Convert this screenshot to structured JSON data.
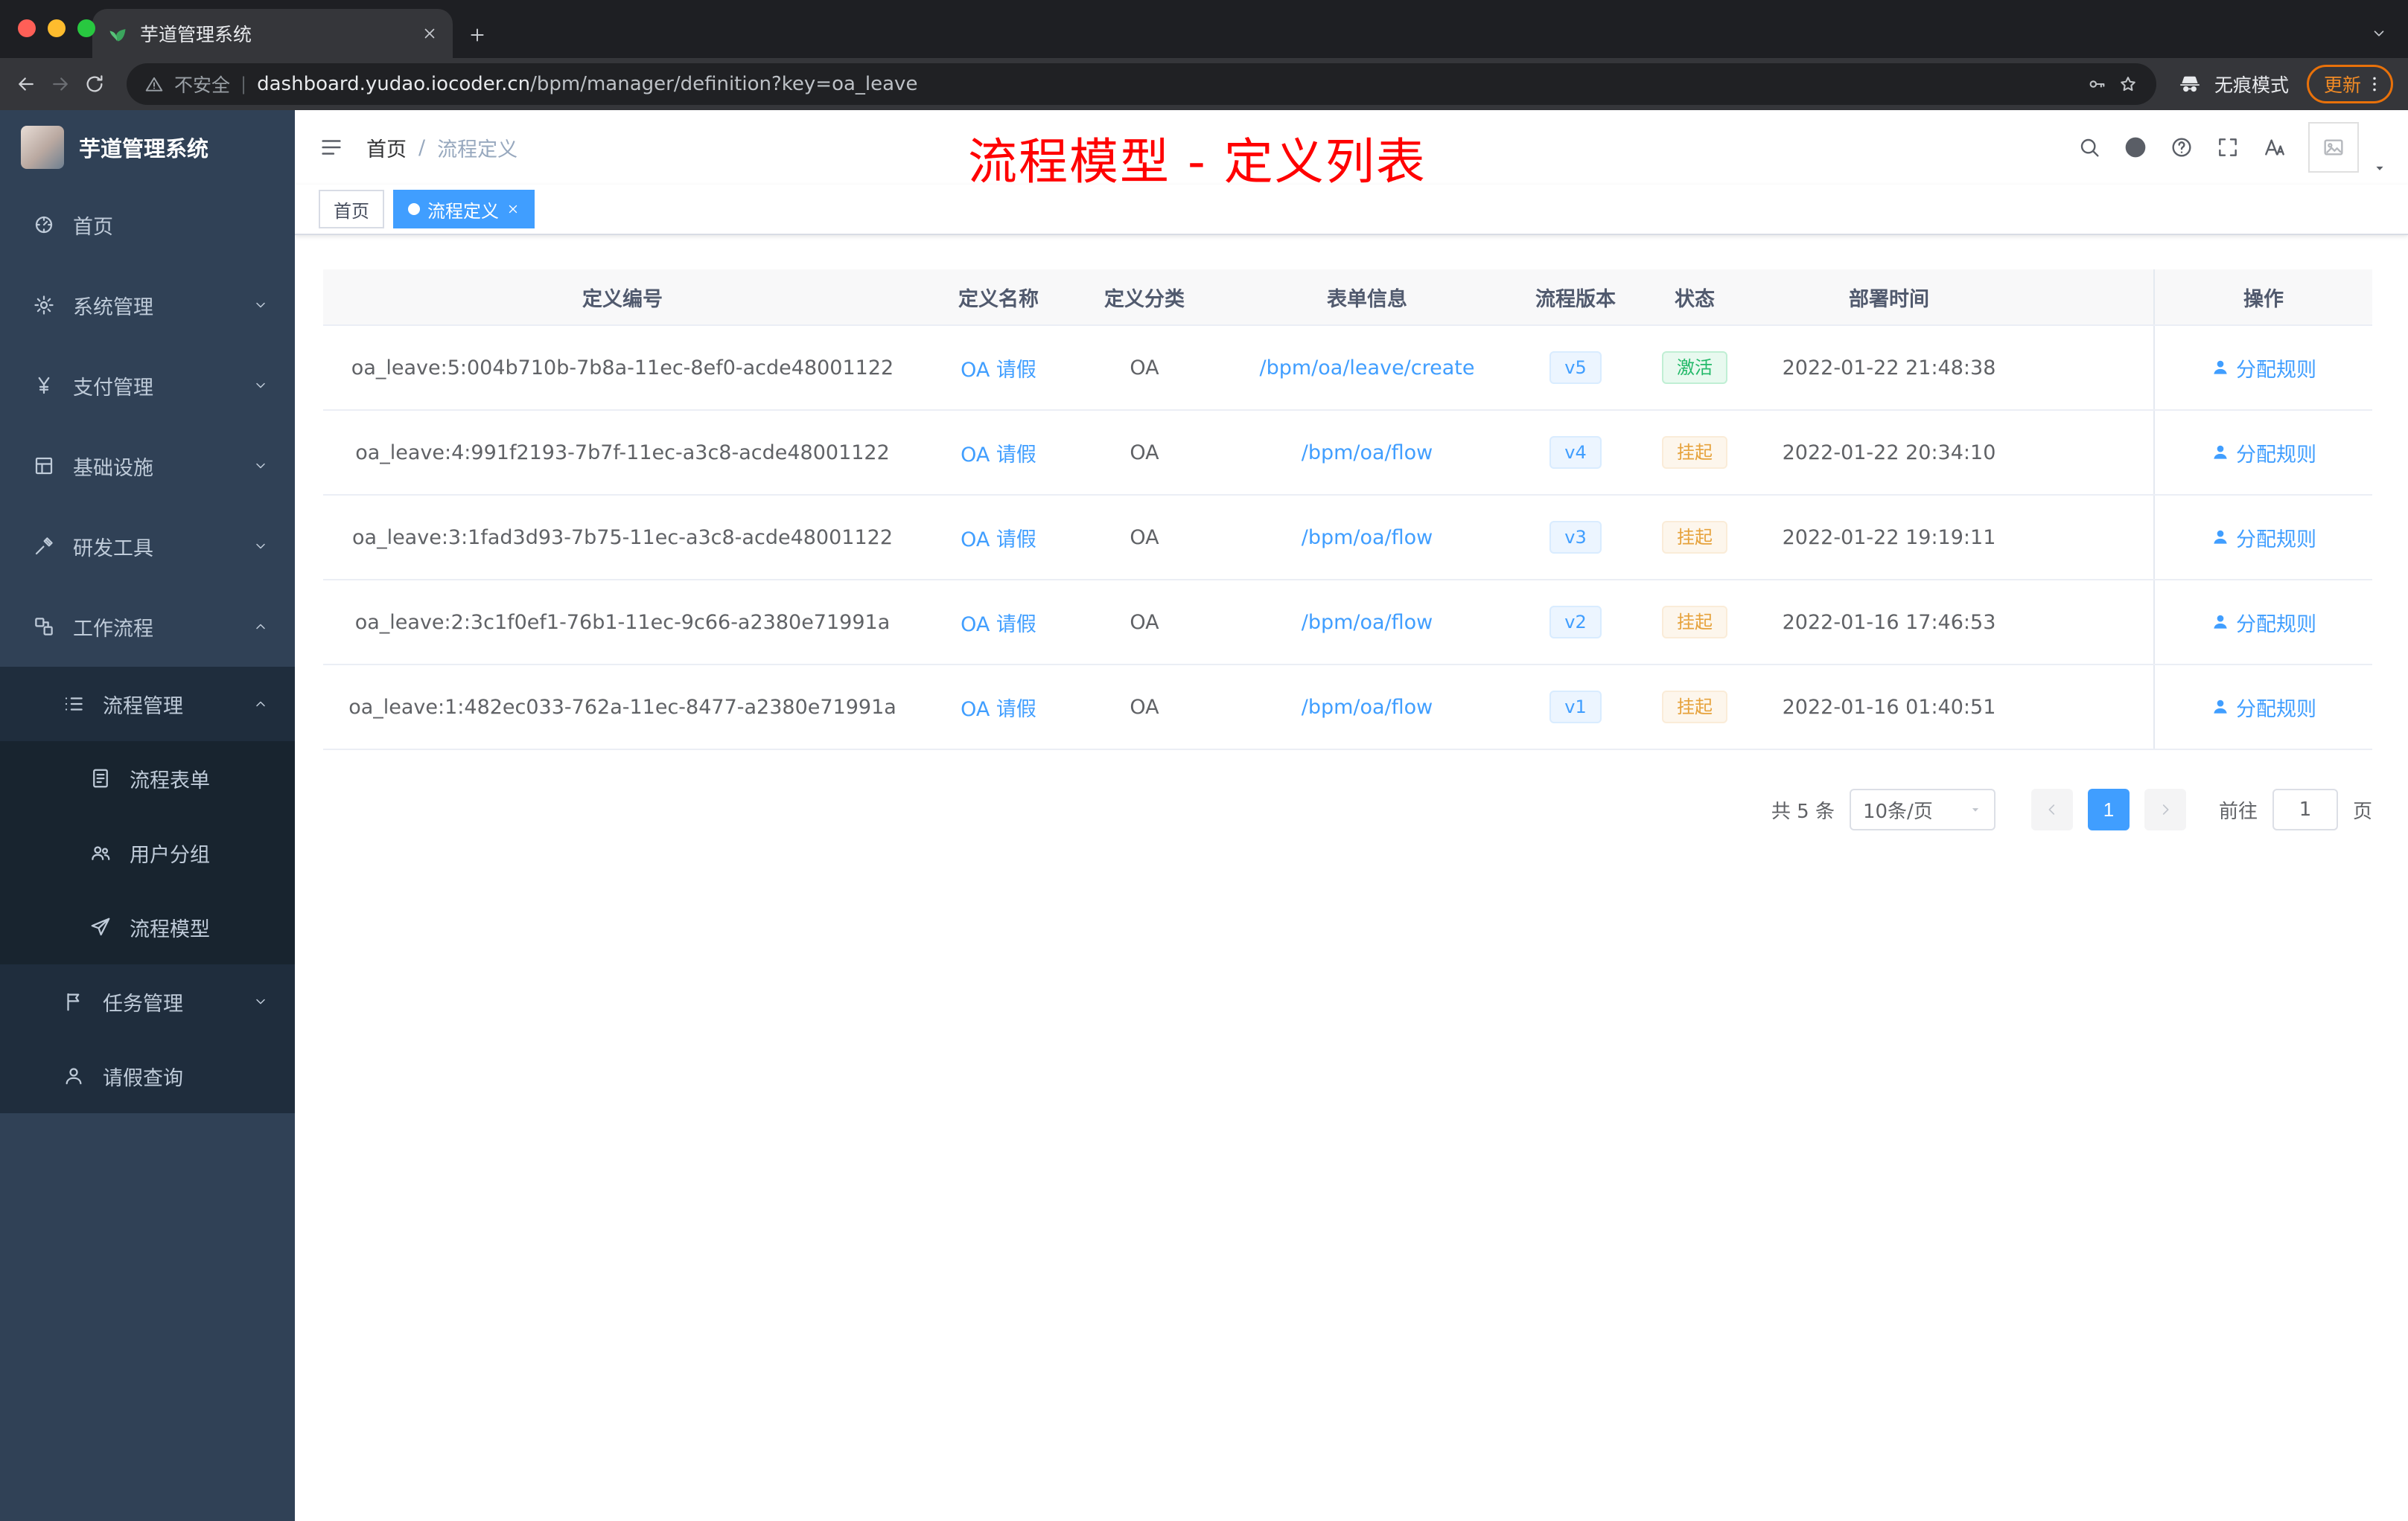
{
  "browser": {
    "tab_title": "芋道管理系统",
    "security_label": "不安全",
    "url_host": "dashboard.yudao.iocoder.cn",
    "url_path": "/bpm/manager/definition?key=oa_leave",
    "incognito_label": "无痕模式",
    "update_label": "更新"
  },
  "sidebar": {
    "title": "芋道管理系统",
    "menu": [
      {
        "label": "首页",
        "icon": "dashboard-icon",
        "level": 1,
        "chevron": ""
      },
      {
        "label": "系统管理",
        "icon": "gear-icon",
        "level": 1,
        "chevron": "down"
      },
      {
        "label": "支付管理",
        "icon": "yen-icon",
        "level": 1,
        "chevron": "down"
      },
      {
        "label": "基础设施",
        "icon": "infra-icon",
        "level": 1,
        "chevron": "down"
      },
      {
        "label": "研发工具",
        "icon": "tools-icon",
        "level": 1,
        "chevron": "down"
      },
      {
        "label": "工作流程",
        "icon": "workflow-icon",
        "level": 1,
        "chevron": "up"
      },
      {
        "label": "流程管理",
        "icon": "list-icon",
        "level": 2,
        "chevron": "up"
      },
      {
        "label": "流程表单",
        "icon": "form-icon",
        "level": 3,
        "chevron": ""
      },
      {
        "label": "用户分组",
        "icon": "group-icon",
        "level": 3,
        "chevron": ""
      },
      {
        "label": "流程模型",
        "icon": "send-icon",
        "level": 3,
        "chevron": ""
      },
      {
        "label": "任务管理",
        "icon": "tasks-icon",
        "level": 2,
        "chevron": "down"
      },
      {
        "label": "请假查询",
        "icon": "user-icon",
        "level": 2,
        "chevron": ""
      }
    ]
  },
  "header": {
    "breadcrumb": [
      "首页",
      "流程定义"
    ],
    "separator": "/",
    "annotation": "流程模型 - 定义列表"
  },
  "tags": [
    {
      "label": "首页",
      "active": false,
      "closable": false
    },
    {
      "label": "流程定义",
      "active": true,
      "closable": true
    }
  ],
  "table": {
    "columns": [
      "定义编号",
      "定义名称",
      "定义分类",
      "表单信息",
      "流程版本",
      "状态",
      "部署时间",
      "操作"
    ],
    "action_label": "分配规则",
    "rows": [
      {
        "id": "oa_leave:5:004b710b-7b8a-11ec-8ef0-acde48001122",
        "name": "OA 请假",
        "category": "OA",
        "form": "/bpm/oa/leave/create",
        "version": "v5",
        "status": "激活",
        "status_type": "success",
        "time": "2022-01-22 21:48:38"
      },
      {
        "id": "oa_leave:4:991f2193-7b7f-11ec-a3c8-acde48001122",
        "name": "OA 请假",
        "category": "OA",
        "form": "/bpm/oa/flow",
        "version": "v4",
        "status": "挂起",
        "status_type": "warning",
        "time": "2022-01-22 20:34:10"
      },
      {
        "id": "oa_leave:3:1fad3d93-7b75-11ec-a3c8-acde48001122",
        "name": "OA 请假",
        "category": "OA",
        "form": "/bpm/oa/flow",
        "version": "v3",
        "status": "挂起",
        "status_type": "warning",
        "time": "2022-01-22 19:19:11"
      },
      {
        "id": "oa_leave:2:3c1f0ef1-76b1-11ec-9c66-a2380e71991a",
        "name": "OA 请假",
        "category": "OA",
        "form": "/bpm/oa/flow",
        "version": "v2",
        "status": "挂起",
        "status_type": "warning",
        "time": "2022-01-16 17:46:53"
      },
      {
        "id": "oa_leave:1:482ec033-762a-11ec-8477-a2380e71991a",
        "name": "OA 请假",
        "category": "OA",
        "form": "/bpm/oa/flow",
        "version": "v1",
        "status": "挂起",
        "status_type": "warning",
        "time": "2022-01-16 01:40:51"
      }
    ]
  },
  "pagination": {
    "total_label": "共 5 条",
    "page_size": "10条/页",
    "current_page": "1",
    "goto_label": "前往",
    "goto_value": "1",
    "page_label": "页"
  },
  "colors": {
    "accent": "#409eff",
    "sidebar_bg": "#304156",
    "submenu_bg": "#1f2d3d",
    "annotation": "#ff0000",
    "status_success": "#23b969",
    "status_warning": "#e6a23c"
  }
}
